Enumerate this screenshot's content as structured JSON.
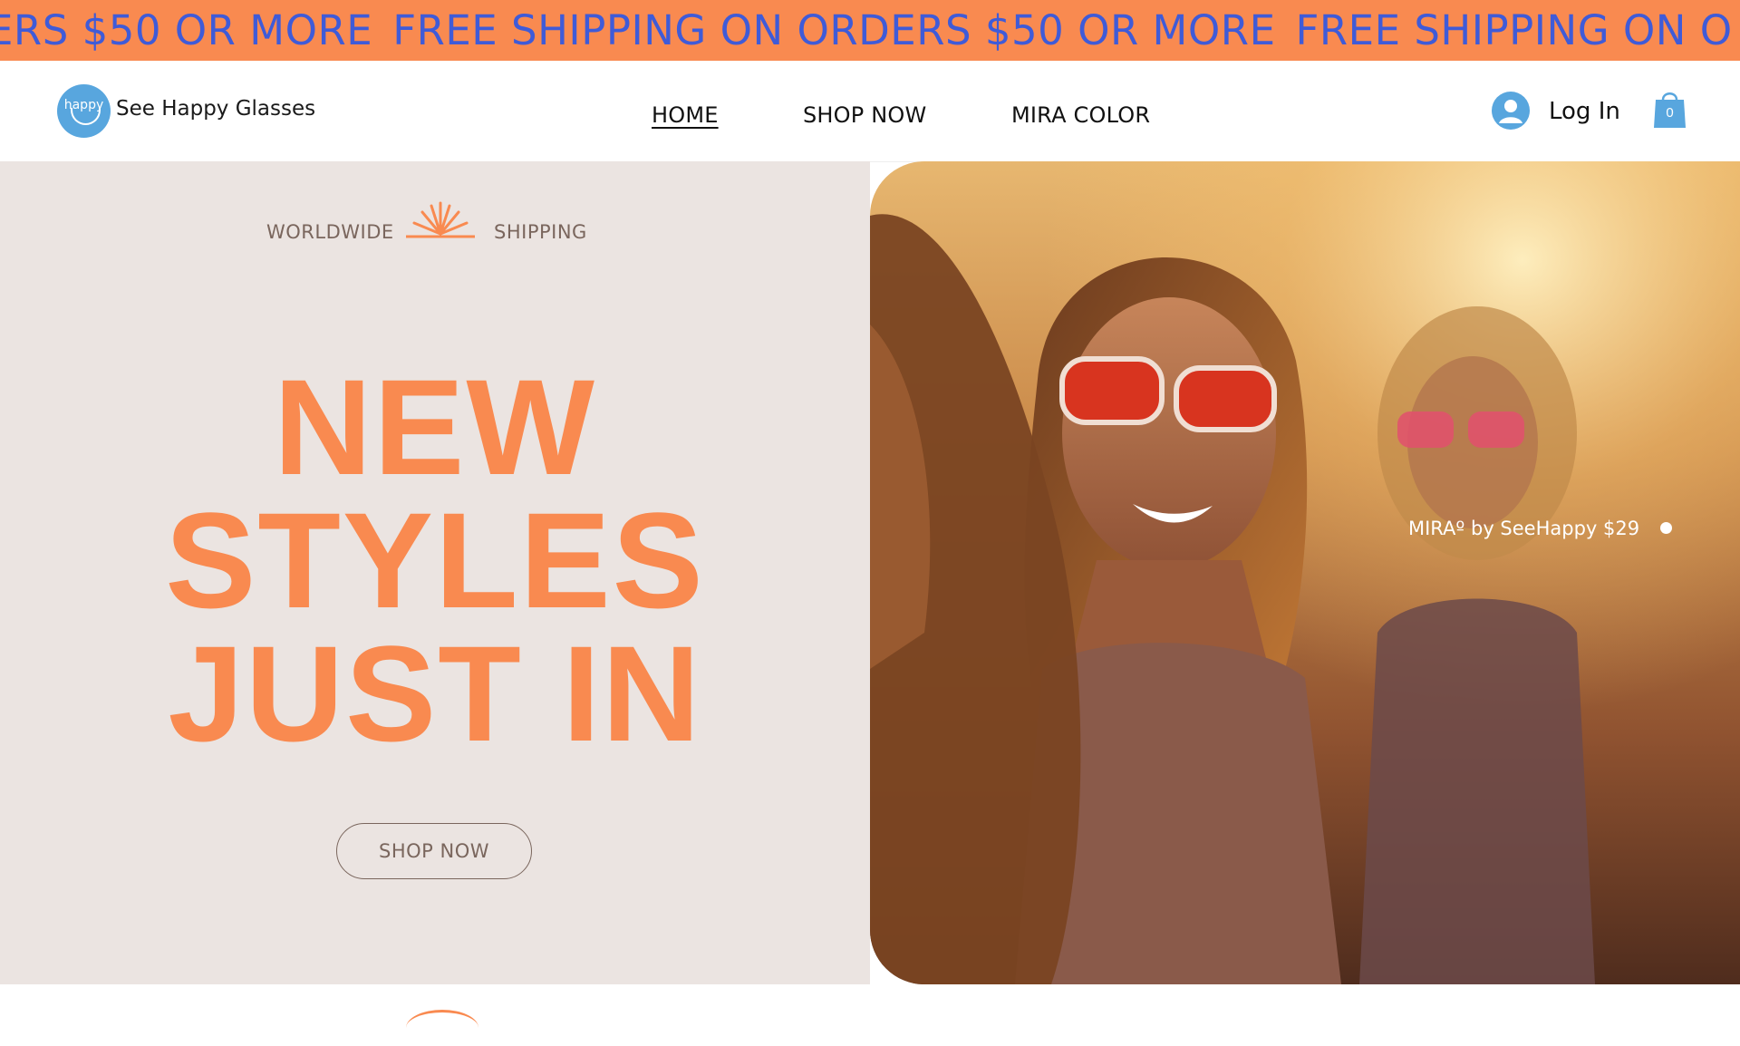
{
  "banner": {
    "text": "FREE SHIPPING ON ORDERS $50 OR MORE",
    "lead_fragment": "ERS $50 OR MORE",
    "tail_fragment": "FREE SHIPPING ON O",
    "background": "#F98A50",
    "text_color": "#3F5BD8"
  },
  "header": {
    "brand_logo_word": "happy",
    "brand_name": "See Happy Glasses",
    "nav": [
      {
        "label": "HOME",
        "active": true
      },
      {
        "label": "SHOP NOW",
        "active": false
      },
      {
        "label": "MIRA COLOR",
        "active": false
      }
    ],
    "login_label": "Log In",
    "cart_count": "0",
    "icons": {
      "account": "user-avatar-icon",
      "cart": "shopping-bag-icon",
      "logo": "smile-logo"
    },
    "accent_color": "#58A6DE"
  },
  "hero": {
    "shipping_left": "WORLDWIDE",
    "shipping_right": "SHIPPING",
    "headline_lines": [
      "NEW",
      "STYLES",
      "JUST IN"
    ],
    "cta_label": "SHOP NOW",
    "headline_color": "#F98A50",
    "background": "#EBE4E1",
    "sun_icon": "sunburst-icon"
  },
  "photo": {
    "caption": "MIRAº by SeeHappy $29",
    "slide_indicator": "slide-dot-icon"
  }
}
